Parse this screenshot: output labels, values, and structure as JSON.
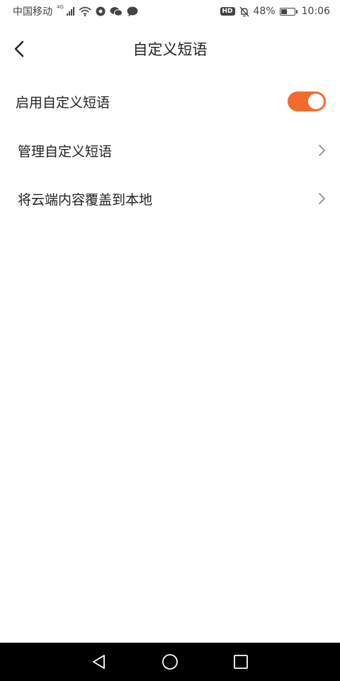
{
  "status_bar": {
    "carrier": "中国移动",
    "network": "4G",
    "battery_percent": "48%",
    "battery_level": 0.48,
    "time": "10:06",
    "hd_label": "HD"
  },
  "header": {
    "title": "自定义短语",
    "back_icon": "chevron-left-icon"
  },
  "settings": {
    "enable_label": "启用自定义短语",
    "enable_on": true,
    "manage_label": "管理自定义短语",
    "overwrite_label": "将云端内容覆盖到本地"
  },
  "colors": {
    "accent": "#f26b2e",
    "nav_bg": "#000000"
  },
  "icons": [
    "wifi-icon",
    "circle-icon",
    "wechat-icon",
    "chat-bubble-icon",
    "mute-bell-icon",
    "chevron-right-icon",
    "back-triangle-icon",
    "home-circle-icon",
    "recents-square-icon"
  ]
}
